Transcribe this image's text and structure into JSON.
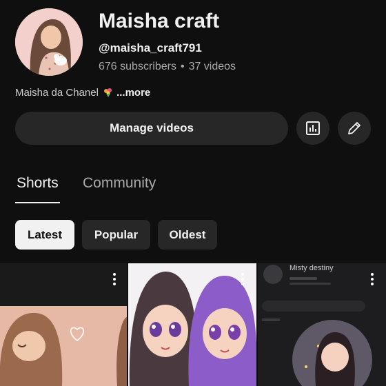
{
  "channel": {
    "name": "Maisha craft",
    "handle": "@maisha_craft791",
    "subscribers": "676 subscribers",
    "separator": "•",
    "videos": "37 videos",
    "description": "Maisha da Chanel",
    "more_label": "...more"
  },
  "actions": {
    "manage_label": "Manage videos",
    "analytics_icon": "analytics-icon",
    "edit_icon": "pencil-icon"
  },
  "tabs": [
    {
      "label": "Shorts",
      "selected": true
    },
    {
      "label": "Community",
      "selected": false
    }
  ],
  "chips": [
    {
      "label": "Latest",
      "selected": true
    },
    {
      "label": "Popular",
      "selected": false
    },
    {
      "label": "Oldest",
      "selected": false
    }
  ],
  "shorts": {
    "third_overlay_title": "Misty destiny"
  },
  "colors": {
    "background": "#0f0f0f",
    "surface": "#272727",
    "text": "#f1f1f1",
    "muted": "#aaaaaa",
    "hijab_purple": "#8c5cc8"
  }
}
